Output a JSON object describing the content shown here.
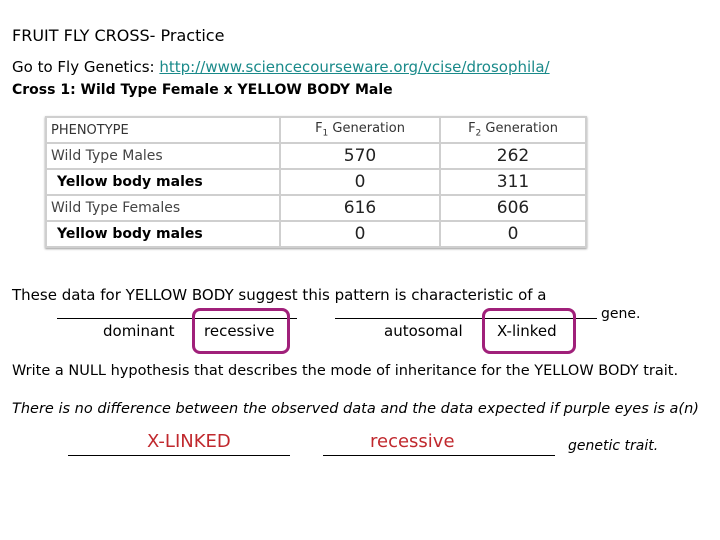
{
  "title": "FRUIT FLY CROSS- Practice",
  "goto": {
    "prefix": "Go to Fly Genetics:",
    "link": "http://www.sciencecourseware.org/vcise/drosophila/"
  },
  "cross": "Cross 1: Wild Type Female x YELLOW BODY Male",
  "table": {
    "headers": [
      "PHENOTYPE",
      "F",
      "1",
      " Generation",
      "F",
      "2",
      " Generation"
    ],
    "header_labels": {
      "phenotype": "PHENOTYPE",
      "f1_base": "F",
      "f1_sub": "1",
      "f1_rest": " Generation",
      "f2_base": "F",
      "f2_sub": "2",
      "f2_rest": " Generation"
    },
    "rows": [
      {
        "phenotype": "Wild Type Males",
        "f1": "570",
        "f2": "262"
      },
      {
        "phenotype": "Yellow body  males",
        "f1": "0",
        "f2": "311"
      },
      {
        "phenotype": "Wild Type Females",
        "f1": "616",
        "f2": "606"
      },
      {
        "phenotype": "Yellow body  males",
        "f1": "0",
        "f2": "0"
      }
    ]
  },
  "question1": {
    "text": "These data for YELLOW BODY suggest this pattern is characteristic of a",
    "options": [
      "dominant",
      "recessive",
      "autosomal",
      "X-linked"
    ],
    "selected": [
      "recessive",
      "X-linked"
    ],
    "suffix": "gene.",
    "highlight_color": "#a0207a"
  },
  "question2": {
    "text": "Write a NULL hypothesis that describes the mode of inheritance for the YELLOW BODY trait.",
    "hypothesis": "There is no difference between the observed data and the data expected if  purple eyes is a(n)",
    "answer1": "X-LINKED",
    "answer2": "recessive",
    "suffix": "genetic trait.",
    "answer_color": "#c0282d"
  }
}
